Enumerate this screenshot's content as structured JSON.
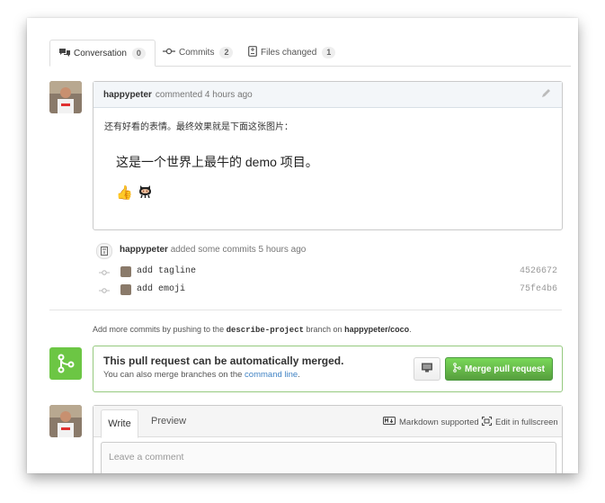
{
  "tabs": [
    {
      "label": "Conversation",
      "count": "0",
      "icon": "comment-icon"
    },
    {
      "label": "Commits",
      "count": "2",
      "icon": "commit-icon"
    },
    {
      "label": "Files changed",
      "count": "1",
      "icon": "file-diff-icon"
    }
  ],
  "comment": {
    "author": "happypeter",
    "action": "commented 4 hours ago",
    "intro": "还有好看的表情。最终效果就是下面这张图片：",
    "headline": "这是一个世界上最牛的 demo 项目。",
    "emoji": [
      "👍",
      "octocat"
    ]
  },
  "commits_event": {
    "author": "happypeter",
    "action": "added some commits 5 hours ago",
    "commits": [
      {
        "message": "add tagline",
        "sha": "4526672"
      },
      {
        "message": "add emoji",
        "sha": "75fe4b6"
      }
    ]
  },
  "push_hint": {
    "prefix": "Add more commits by pushing to the",
    "branch": "describe-project",
    "middle": "branch on",
    "repo": "happypeter/coco",
    "suffix": "."
  },
  "merge": {
    "title": "This pull request can be automatically merged.",
    "subtitle_prefix": "You can also merge branches on the",
    "subtitle_link": "command line",
    "subtitle_suffix": ".",
    "button_label": "Merge pull request"
  },
  "new_comment": {
    "write_tab": "Write",
    "preview_tab": "Preview",
    "markdown_label": "Markdown supported",
    "fullscreen_label": "Edit in fullscreen",
    "placeholder": "Leave a comment"
  },
  "colors": {
    "accent_green": "#6cc644",
    "link_blue": "#4183c4"
  }
}
